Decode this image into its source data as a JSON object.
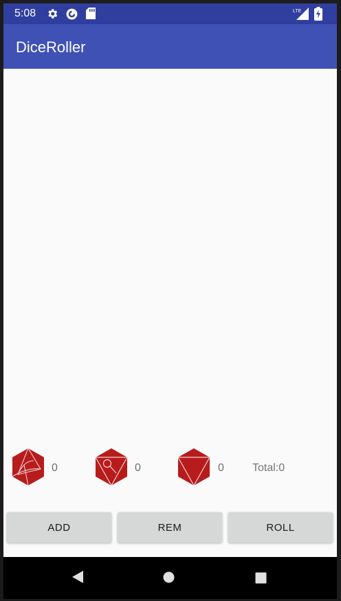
{
  "status_bar": {
    "time": "5:08",
    "icons": [
      "settings-icon",
      "sync-icon",
      "sd-card-icon",
      "lte-signal-icon",
      "battery-charging-icon"
    ],
    "lte_label": "LTE"
  },
  "app_bar": {
    "title": "DiceRoller"
  },
  "dice": [
    {
      "icon": "d20-die-icon",
      "count": "0"
    },
    {
      "icon": "d20-die-icon",
      "count": "0"
    },
    {
      "icon": "d20-die-icon",
      "count": "0"
    }
  ],
  "total_label": "Total:0",
  "buttons": {
    "add": "ADD",
    "rem": "REM",
    "roll": "ROLL"
  },
  "nav_bar": {
    "icons": [
      "back-icon",
      "home-icon",
      "recents-icon"
    ]
  },
  "colors": {
    "status_bar": "#303f9f",
    "app_bar": "#3f51b5",
    "die_red": "#b71c1c",
    "button_bg": "#d6d7d7"
  }
}
